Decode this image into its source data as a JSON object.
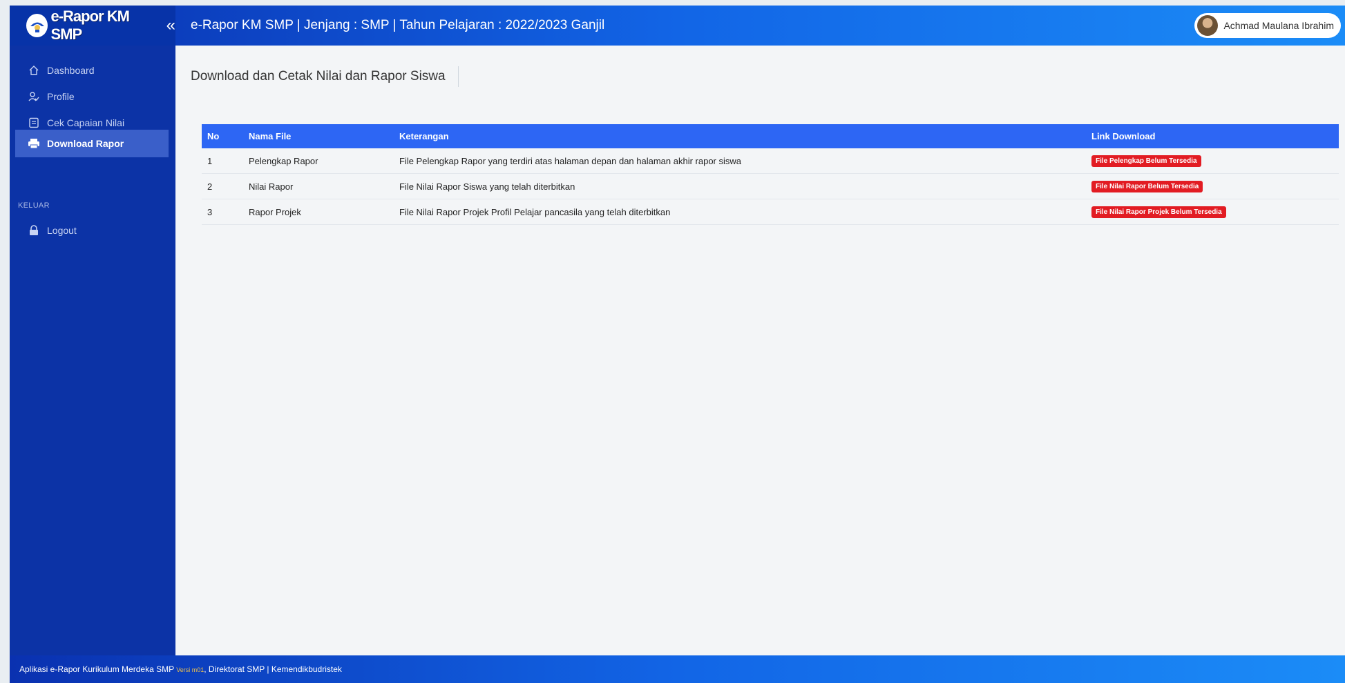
{
  "brand": {
    "name": "e-Rapor KM SMP",
    "collapse_icon": "«"
  },
  "topbar": {
    "title": "e-Rapor KM SMP | Jenjang : SMP | Tahun Pelajaran : 2022/2023 Ganjil"
  },
  "user": {
    "name": "Achmad Maulana Ibrahim"
  },
  "sidebar": {
    "items": [
      {
        "label": "Dashboard",
        "icon": "home-icon"
      },
      {
        "label": "Profile",
        "icon": "user-icon"
      },
      {
        "label": "Cek Capaian Nilai",
        "icon": "document-icon"
      },
      {
        "label": "Download Rapor",
        "icon": "printer-icon",
        "active": true
      }
    ],
    "section_label": "KELUAR",
    "logout": {
      "label": "Logout",
      "icon": "lock-icon"
    }
  },
  "page": {
    "title": "Download dan Cetak Nilai dan Rapor Siswa"
  },
  "table": {
    "headers": [
      "No",
      "Nama File",
      "Keterangan",
      "Link Download"
    ],
    "rows": [
      {
        "no": "1",
        "name": "Pelengkap Rapor",
        "desc": "File Pelengkap Rapor yang terdiri atas halaman depan dan halaman akhir rapor siswa",
        "link": "File Pelengkap Belum Tersedia"
      },
      {
        "no": "2",
        "name": "Nilai Rapor",
        "desc": "File Nilai Rapor Siswa yang telah diterbitkan",
        "link": "File Nilai Rapor Belum Tersedia"
      },
      {
        "no": "3",
        "name": "Rapor Projek",
        "desc": "File Nilai Rapor Projek Profil Pelajar pancasila yang telah diterbitkan",
        "link": "File Nilai Rapor Projek Belum Tersedia"
      }
    ]
  },
  "footer": {
    "prefix": "Aplikasi e-Rapor Kurikulum Merdeka SMP",
    "version": "Versi m01",
    "suffix": ", Direktorat SMP | Kemendikbudristek"
  },
  "colors": {
    "primary": "#0c33a6",
    "header_blue": "#2d66f4",
    "badge_red": "#e21c23"
  }
}
